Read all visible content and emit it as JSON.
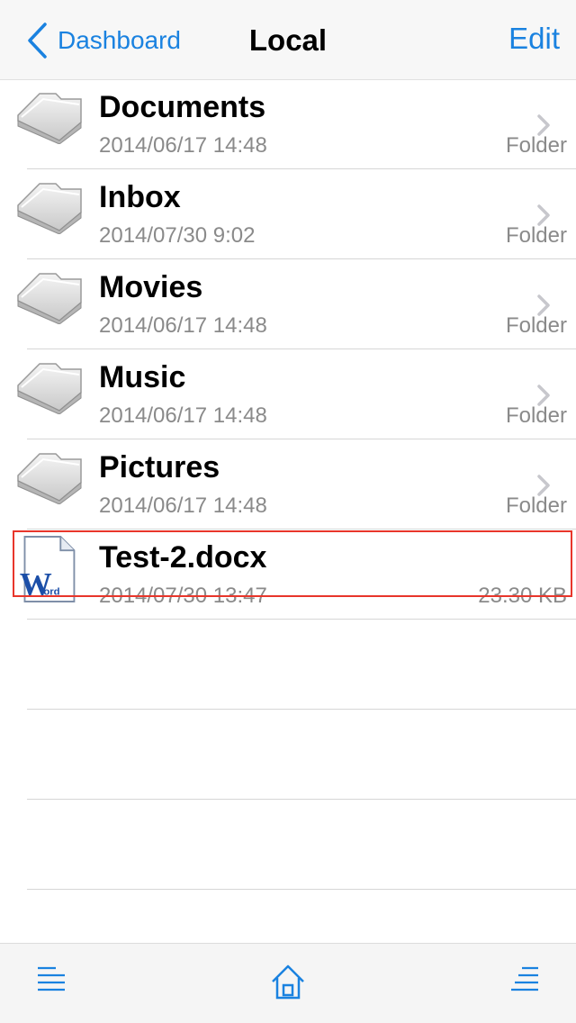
{
  "nav": {
    "back_label": "Dashboard",
    "title": "Local",
    "edit_label": "Edit"
  },
  "items": [
    {
      "name": "Documents",
      "date": "2014/06/17 14:48",
      "kind": "Folder",
      "type": "folder"
    },
    {
      "name": "Inbox",
      "date": "2014/07/30 9:02",
      "kind": "Folder",
      "type": "folder"
    },
    {
      "name": "Movies",
      "date": "2014/06/17 14:48",
      "kind": "Folder",
      "type": "folder"
    },
    {
      "name": "Music",
      "date": "2014/06/17 14:48",
      "kind": "Folder",
      "type": "folder"
    },
    {
      "name": "Pictures",
      "date": "2014/06/17 14:48",
      "kind": "Folder",
      "type": "folder"
    },
    {
      "name": "Test-2.docx",
      "date": "2014/07/30 13:47",
      "kind": "23.30 KB",
      "type": "word-document",
      "highlighted": true
    }
  ],
  "word_icon_text": {
    "big": "W",
    "small": "ord"
  },
  "toolbar": {
    "left_icon": "menu-lines-icon",
    "center_icon": "home-icon",
    "right_icon": "sort-lines-icon"
  },
  "colors": {
    "accent": "#1a82e0",
    "highlight": "#e8362b"
  }
}
